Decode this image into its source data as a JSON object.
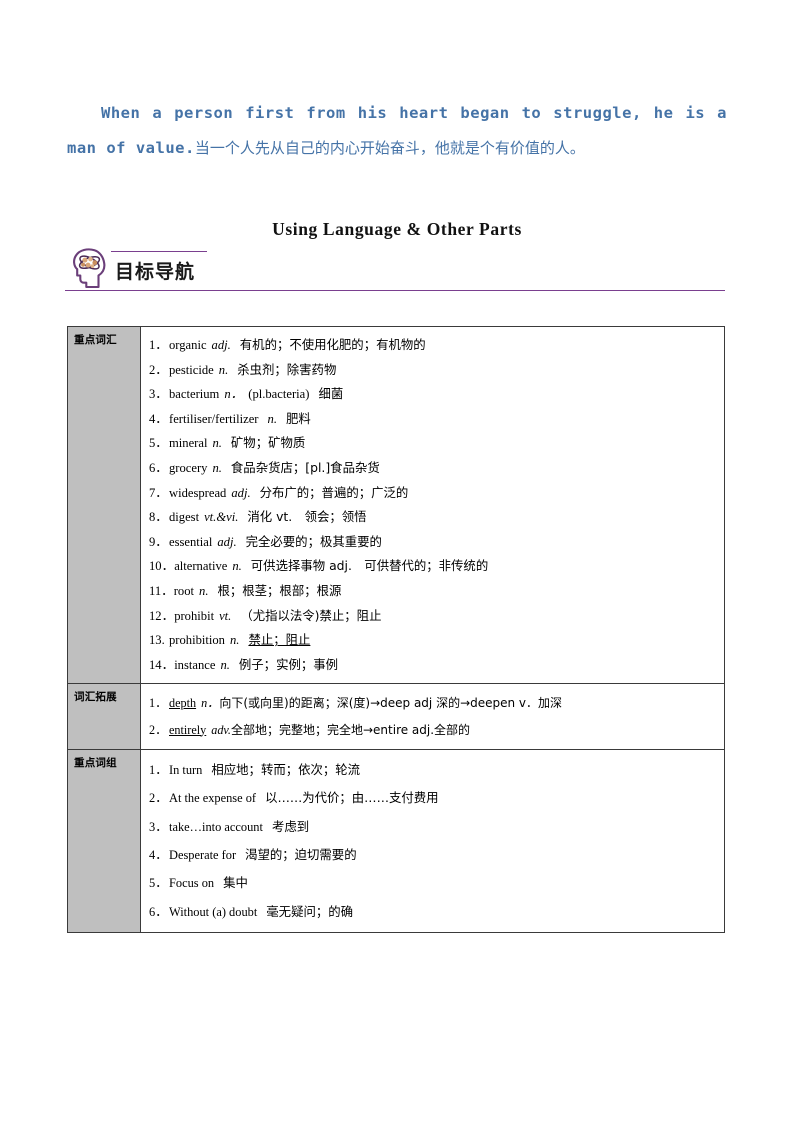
{
  "quote": {
    "english": "When a person first from his heart began to struggle, he is a man of value.",
    "chinese": "当一个人先从自己的内心开始奋斗，他就是个有价值的人。",
    "color": "#4573a7"
  },
  "section_title": "Using Language & Other Parts",
  "banner": {
    "label": "目标导航",
    "icon": "head-brain-icon",
    "rule_color": "#7a3f8f"
  },
  "table": {
    "sections": [
      {
        "category": "重点词汇",
        "items": [
          {
            "num": "1．",
            "word": "organic",
            "pos": "adj.",
            "meaning": "有机的；不使用化肥的；有机物的"
          },
          {
            "num": "2．",
            "word": "pesticide",
            "pos": "n.",
            "meaning": "杀虫剂；除害药物"
          },
          {
            "num": "3．",
            "word": "bacterium",
            "pos": "n．",
            "extra": "(pl.bacteria)",
            "meaning": "细菌"
          },
          {
            "num": "4．",
            "word": "fertiliser/fertilizer",
            "pos": "n.",
            "meaning": "肥料"
          },
          {
            "num": "5．",
            "word": "mineral",
            "pos": "n.",
            "meaning": "矿物；矿物质"
          },
          {
            "num": "6．",
            "word": "grocery",
            "pos": "n.",
            "meaning": "食品杂货店；[pl.]食品杂货"
          },
          {
            "num": "7．",
            "word": "widespread",
            "pos": "adj.",
            "meaning": "分布广的；普遍的；广泛的"
          },
          {
            "num": "8．",
            "word": "digest",
            "pos": "vt.&vi.",
            "meaning": "消化 vt.　领会；领悟"
          },
          {
            "num": "9．",
            "word": "essential",
            "pos": "adj.",
            "meaning": "完全必要的；极其重要的"
          },
          {
            "num": "10．",
            "word": "alternative",
            "pos": "n.",
            "meaning": "可供选择事物 adj.　可供替代的；非传统的"
          },
          {
            "num": "11．",
            "word": "root",
            "pos": "n.",
            "meaning": "根；根茎；根部；根源"
          },
          {
            "num": "12．",
            "word": "prohibit",
            "pos": "vt.",
            "meaning": "（尤指以法令)禁止；阻止"
          },
          {
            "num": "13.",
            "word": "prohibition",
            "pos": "n.",
            "meaning": "禁止；阻止"
          },
          {
            "num": "14．",
            "word": "instance",
            "pos": "n.",
            "meaning": "例子；实例；事例"
          }
        ]
      },
      {
        "category": "词汇拓展",
        "items": [
          {
            "num": "1．",
            "word": "depth",
            "pos": "n．",
            "meaning": "向下(或向里)的距离；深(度)→deep adj 深的→deepen v．加深"
          },
          {
            "num": "2．",
            "word": "entirely",
            "pos": "adv.",
            "meaning": "全部地；完整地；完全地→entire adj.全部的"
          }
        ]
      },
      {
        "category": "重点词组",
        "items": [
          {
            "num": "1．",
            "word": "In turn",
            "meaning": "相应地；转而；依次；轮流"
          },
          {
            "num": "2．",
            "word": "At the expense of",
            "meaning": "以……为代价；由……支付费用"
          },
          {
            "num": "3．",
            "word": "take…into account",
            "meaning": "考虑到"
          },
          {
            "num": "4．",
            "word": "Desperate for",
            "meaning": "渴望的；迫切需要的"
          },
          {
            "num": "5．",
            "word": "Focus on",
            "meaning": "集中"
          },
          {
            "num": "6．",
            "word": "Without (a) doubt",
            "meaning": "毫无疑问；的确"
          }
        ]
      }
    ]
  }
}
